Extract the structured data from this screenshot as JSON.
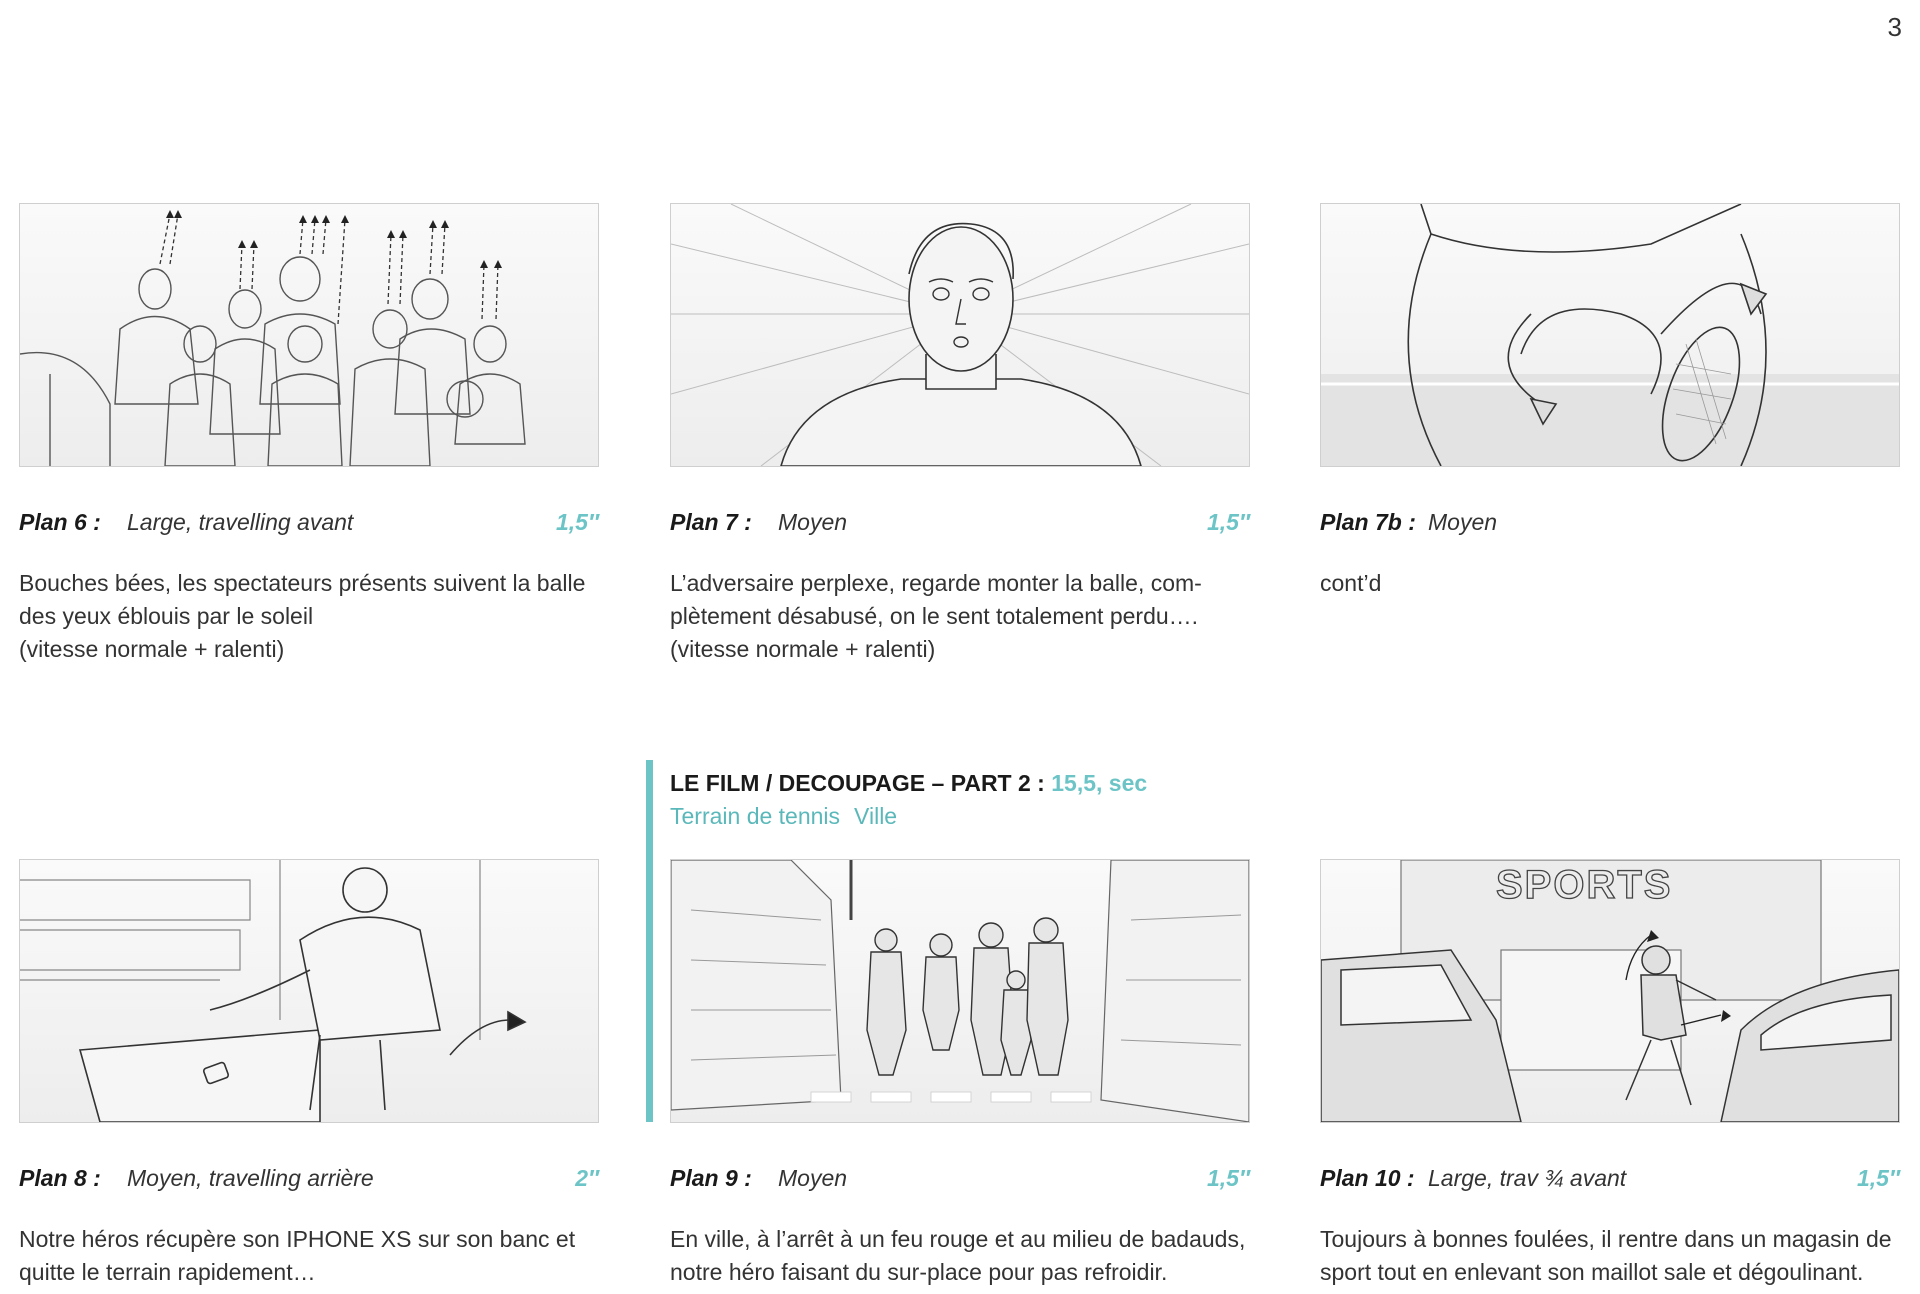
{
  "page_number": "3",
  "section": {
    "title": "LE FILM / DECOUPAGE – PART 2 : ",
    "duration": "15,5, sec",
    "locations": [
      "Terrain de tennis",
      "Ville"
    ]
  },
  "panels": [
    {
      "label": "Plan 6 :",
      "type": "Large, travelling avant",
      "duration": "1,5″",
      "description": [
        "Bouches bées, les spectateurs présents suivent la balle",
        "des yeux éblouis par le soleil",
        "(vitesse normale + ralenti)"
      ],
      "sketch": "spectators-crowd-sketch"
    },
    {
      "label": "Plan 7 :",
      "type": "Moyen",
      "duration": "1,5″",
      "description": [
        "L’adversaire perplexe, regarde monter la balle, com-",
        "plètement désabusé, on le sent totalement perdu….",
        "(vitesse normale + ralenti)"
      ],
      "sketch": "opponent-face-sketch"
    },
    {
      "label": "Plan 7b :",
      "type": "Moyen",
      "duration": "",
      "description": [
        "cont’d"
      ],
      "sketch": "racket-hands-sketch"
    },
    {
      "label": "Plan 8 :",
      "type": "Moyen, travelling arrière",
      "duration": "2″",
      "description": [
        "Notre héros récupère son IPHONE XS sur son banc et",
        "quitte le terrain rapidement…"
      ],
      "sketch": "hero-bench-phone-sketch"
    },
    {
      "label": "Plan 9 :",
      "type": "Moyen",
      "duration": "1,5″",
      "description": [
        "En ville, à l’arrêt à un feu rouge et au milieu de badauds,",
        "notre héro faisant du sur-place pour pas refroidir."
      ],
      "sketch": "city-crosswalk-sketch"
    },
    {
      "label": "Plan 10 :",
      "type": "Large, trav ¾ avant",
      "duration": "1,5″",
      "description": [
        "Toujours à bonnes foulées, il rentre dans un magasin de",
        "sport tout en enlevant son maillot sale et dégoulinant."
      ],
      "sketch": "sports-store-sketch",
      "sign_text": "SPORTS"
    }
  ]
}
